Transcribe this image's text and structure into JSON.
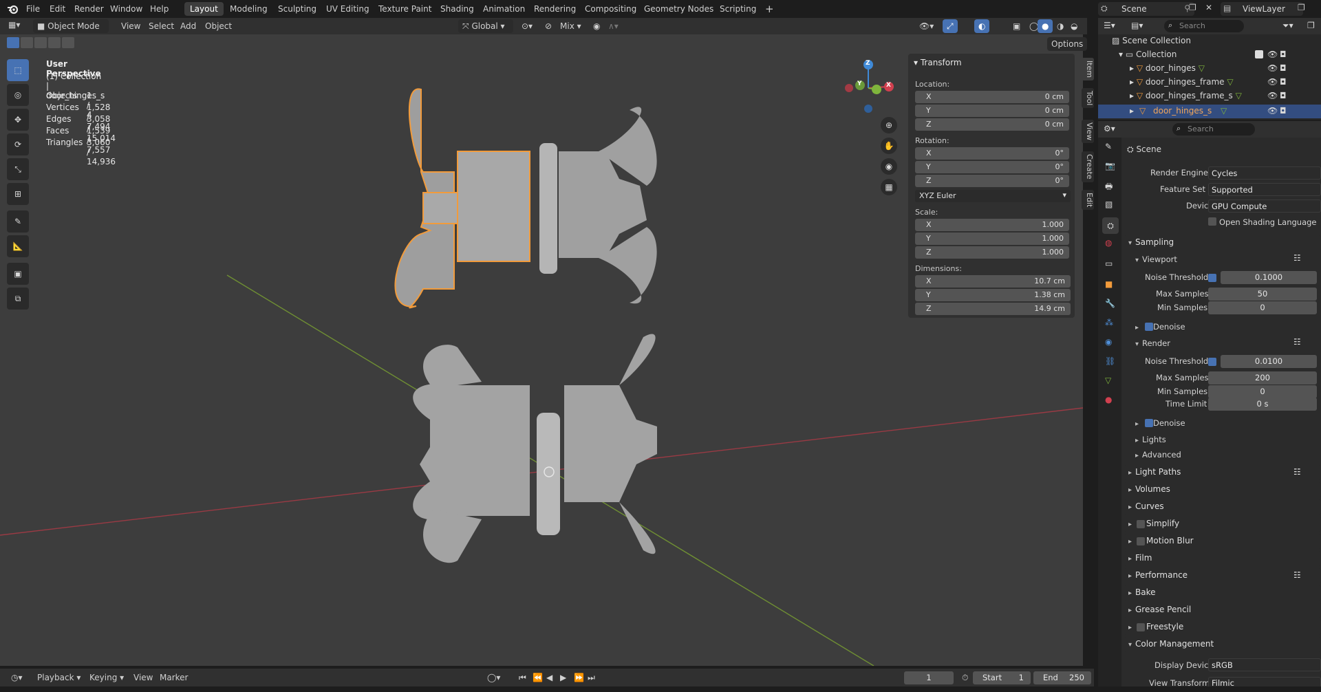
{
  "topbar": {
    "menus": [
      "File",
      "Edit",
      "Render",
      "Window",
      "Help"
    ],
    "workspaces": [
      "Layout",
      "Modeling",
      "Sculpting",
      "UV Editing",
      "Texture Paint",
      "Shading",
      "Animation",
      "Rendering",
      "Compositing",
      "Geometry Nodes",
      "Scripting"
    ],
    "active_workspace": "Layout",
    "add_workspace": "+",
    "scene": "Scene",
    "view_layer": "ViewLayer"
  },
  "viewport_header": {
    "mode": "Object Mode",
    "menus": [
      "View",
      "Select",
      "Add",
      "Object"
    ],
    "orientation": "Global",
    "pivot": "Mix",
    "options": "Options"
  },
  "overlay": {
    "perspective": "User Perspective",
    "collection": "(1) Collection | door_hinges_s",
    "stats": [
      {
        "label": "Objects",
        "value": "1 / 4"
      },
      {
        "label": "Vertices",
        "value": "1,528 / 7,494"
      },
      {
        "label": "Edges",
        "value": "3,058 / 15,014"
      },
      {
        "label": "Faces",
        "value": "1,539 / 7,557"
      },
      {
        "label": "Triangles",
        "value": "3,060 / 14,936"
      }
    ]
  },
  "gizmo": {
    "x": "X",
    "y": "Y",
    "z": "Z"
  },
  "npanel": {
    "title": "Transform",
    "location_label": "Location:",
    "location": [
      {
        "axis": "X",
        "value": "0 cm"
      },
      {
        "axis": "Y",
        "value": "0 cm"
      },
      {
        "axis": "Z",
        "value": "0 cm"
      }
    ],
    "rotation_label": "Rotation:",
    "rotation": [
      {
        "axis": "X",
        "value": "0°"
      },
      {
        "axis": "Y",
        "value": "0°"
      },
      {
        "axis": "Z",
        "value": "0°"
      }
    ],
    "rotation_mode": "XYZ Euler",
    "scale_label": "Scale:",
    "scale": [
      {
        "axis": "X",
        "value": "1.000"
      },
      {
        "axis": "Y",
        "value": "1.000"
      },
      {
        "axis": "Z",
        "value": "1.000"
      }
    ],
    "dimensions_label": "Dimensions:",
    "dimensions": [
      {
        "axis": "X",
        "value": "10.7 cm"
      },
      {
        "axis": "Y",
        "value": "1.38 cm"
      },
      {
        "axis": "Z",
        "value": "14.9 cm"
      }
    ],
    "tabs": [
      "Item",
      "Tool",
      "View",
      "Create",
      "Edit"
    ]
  },
  "outliner": {
    "search_placeholder": "Search",
    "root": "Scene Collection",
    "collection": "Collection",
    "items": [
      "door_hinges",
      "door_hinges_frame",
      "door_hinges_frame_s",
      "door_hinges_s"
    ],
    "selected": "door_hinges_s"
  },
  "properties": {
    "search_placeholder": "Search",
    "scene_label": "Scene",
    "render_engine_label": "Render Engine",
    "render_engine": "Cycles",
    "feature_set_label": "Feature Set",
    "feature_set": "Supported",
    "device_label": "Device",
    "device": "GPU Compute",
    "osl_label": "Open Shading Language",
    "sampling": "Sampling",
    "viewport": "Viewport",
    "noise_threshold_label": "Noise Threshold",
    "vp_noise": "0.1000",
    "max_samples_label": "Max Samples",
    "vp_max": "50",
    "min_samples_label": "Min Samples",
    "vp_min": "0",
    "denoise": "Denoise",
    "render": "Render",
    "r_noise": "0.0100",
    "r_max": "200",
    "r_min": "0",
    "time_limit_label": "Time Limit",
    "time_limit": "0 s",
    "lights": "Lights",
    "advanced": "Advanced",
    "sections": [
      "Light Paths",
      "Volumes",
      "Curves",
      "Simplify",
      "Motion Blur",
      "Film",
      "Performance",
      "Bake",
      "Grease Pencil",
      "Freestyle",
      "Color Management"
    ],
    "display_device_label": "Display Device",
    "display_device": "sRGB",
    "view_transform_label": "View Transform",
    "view_transform": "Filmic"
  },
  "timeline": {
    "menus": [
      "Playback",
      "Keying",
      "View",
      "Marker"
    ],
    "current_frame": "1",
    "start_label": "Start",
    "start": "1",
    "end_label": "End",
    "end": "250"
  },
  "colors": {
    "accent": "#4772b3",
    "selection": "#f29b3b",
    "x_axis": "#d1404f",
    "y_axis": "#7fb53c",
    "z_axis": "#3f8ad8"
  }
}
